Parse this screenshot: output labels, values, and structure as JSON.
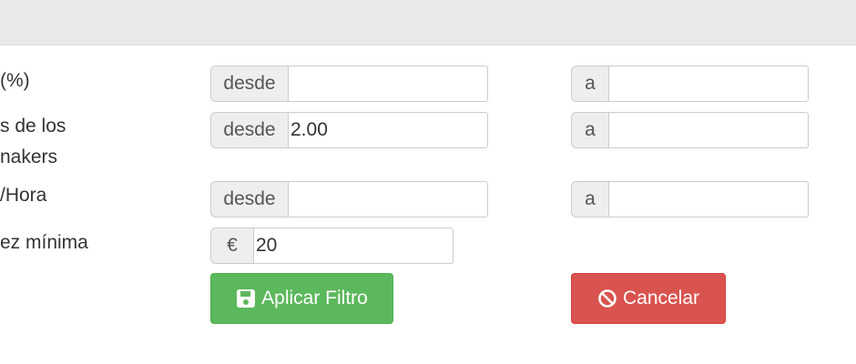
{
  "rows": [
    {
      "label": "(%)",
      "from_addon": "desde",
      "from_value": "",
      "to_addon": "a",
      "to_value": ""
    },
    {
      "label_lines": [
        "s de los",
        "nakers"
      ],
      "from_addon": "desde",
      "from_value": "2.00",
      "to_addon": "a",
      "to_value": ""
    },
    {
      "label": "/Hora",
      "from_addon": "desde",
      "from_value": "",
      "to_addon": "a",
      "to_value": ""
    },
    {
      "label": "ez mínima",
      "currency_addon": "€",
      "value": "20"
    }
  ],
  "buttons": {
    "apply": {
      "label": "Aplicar Filtro",
      "icon": "save-icon",
      "color": "#5cb85c"
    },
    "cancel": {
      "label": "Cancelar",
      "icon": "ban-icon",
      "color": "#d9534f"
    }
  }
}
